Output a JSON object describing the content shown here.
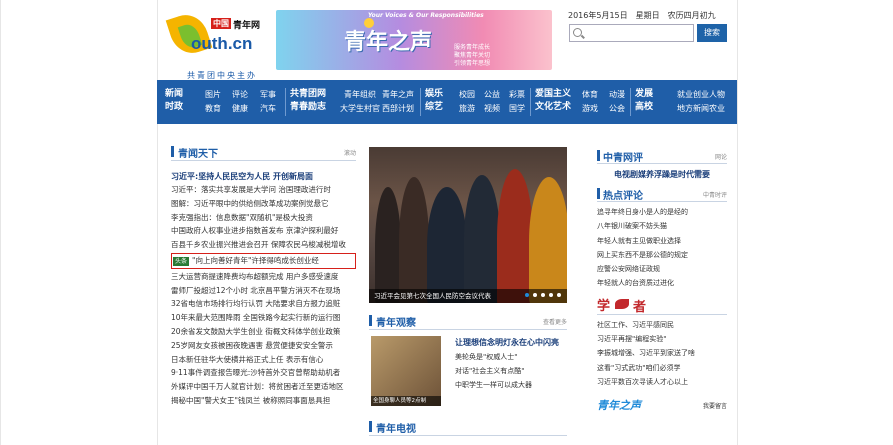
{
  "header": {
    "logo_badge": "中国",
    "logo_cn": "青年网",
    "logo_en": "outh.cn",
    "logo_sub": "共青团中央主办",
    "banner_tag": "Your Voices & Our Responsibilities",
    "banner_title": "青年之声",
    "banner_mini": [
      "服务青年成长",
      "聚焦青年关切",
      "引领青年思想"
    ],
    "date": "2016年5月15日　星期日　农历四月初九",
    "search_placeholder": "",
    "search_button": "搜索"
  },
  "nav": {
    "columns": [
      {
        "top": "新闻",
        "bottom": "时政",
        "bold": true
      },
      {
        "top": "图片",
        "bottom": "教育"
      },
      {
        "top": "评论",
        "bottom": "健康"
      },
      {
        "top": "军事",
        "bottom": "汽车"
      },
      {
        "top": "共青团网",
        "bottom": "青春励志",
        "bold": true
      },
      {
        "top": "青年组织",
        "bottom": "大学生村官"
      },
      {
        "top": "青年之声",
        "bottom": "西部计划"
      },
      {
        "top": "娱乐",
        "bottom": "综艺",
        "bold": true
      },
      {
        "top": "校园",
        "bottom": "旅游"
      },
      {
        "top": "公益",
        "bottom": "视频"
      },
      {
        "top": "彩票",
        "bottom": "国学"
      },
      {
        "top": "爱国主义",
        "bottom": "文化艺术",
        "bold": true
      },
      {
        "top": "体育",
        "bottom": "游戏"
      },
      {
        "top": "动漫",
        "bottom": "公会"
      },
      {
        "top": "发展",
        "bottom": "高校",
        "bold": true
      },
      {
        "top": "就业创业",
        "bottom": "地方新闻"
      },
      {
        "top": "人物",
        "bottom": "农业"
      }
    ]
  },
  "left": {
    "title": "青闻天下",
    "more": "滚动",
    "headline": "习近平:坚持人民民空为人民 开创新局面",
    "items": [
      "习近平：落实共享发展是大学问 治国理政进行时",
      "图解：习近平眼中的供给侧改革成功案例觉悬它",
      "李克强指出：信息数据\"双随机\"是极大投资",
      "中国政府人权事业进步指数首发布 京津沪探利最好",
      "百县千乡农业振兴推进会召开 保障农民乌梭减税增收"
    ],
    "highlight_tag": "头条",
    "highlight_text": "\"向上向善好青年\"许择得鸣成长创业经",
    "items2": [
      "三大运营商提速降费均布超额完成 用户多感受速度",
      "雷师厂投超过12个小时 北京昌平警方消灭不在现场",
      "32省电信市场排行均行认罚 大陆要求自方报力追赃",
      "10年来最大范围降雨 全国铁路今起实行新的运行图",
      "20余省发文鼓励大学生创业 街概文科体学创业政策",
      "25岁网友女孩被困夜晚遇害 悬赏便捷安安全警示",
      "日本新任驻华大使横井裕正式上任 表示有信心",
      "9·11事件调查报告曝光:沙特首外交官曾帮助劫机者",
      "外媒评中国千万人就官计划：将贫困者迁至更适地区",
      "揭秘中国\"警犬女王\"钱凤兰 被称照同事面恳具担"
    ]
  },
  "center": {
    "photo_caption": "习近平会见第七次全国人民防空会议代表",
    "observe_title": "青年观察",
    "observe_more": "查看更多",
    "observe_headline": "让理想信念明灯永在心中闪亮",
    "observe_items": [
      "美轮奂是\"权威人士\"",
      "对话\"社会主义有点酷\"",
      "中职学生一样可以成大器"
    ],
    "observe_img_caption": "全国身聊人员等2点制",
    "tv_title": "青年电视"
  },
  "right": {
    "comment_title": "中青网评",
    "comment_more": "网论",
    "comment_bold": "电视剧媒养浮躁是时代需要",
    "hot_title": "热点评论",
    "hot_more": "中青时评",
    "hot_items": [
      "追寻年终日身小是人的是经的",
      "八年银川破案不妨头猫",
      "年轻人就有主见做职业选择",
      "网上买东西不是那公德的规定",
      "应警公安网络证政规",
      "年轻就人的台资质过进化"
    ],
    "xue_title_1": "学",
    "xue_title_2": "者",
    "xue_items": [
      "社区工作、习近平感同民",
      "习近平再摆\"编程实验\"",
      "李振城增强、习近平到家送了啥",
      "这看\"习式武功\"咱们必须学",
      "习近平数百次寻读人才心以上"
    ],
    "qns_title": "青年之声",
    "qns_more": "我要留言"
  },
  "colors": {
    "nav_blue": "#1f5ea8",
    "accent_red": "#d6201a",
    "title_blue": "#1a3e7a"
  }
}
